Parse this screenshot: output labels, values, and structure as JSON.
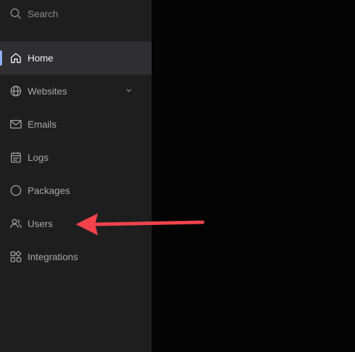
{
  "search": {
    "placeholder": "Search"
  },
  "nav": {
    "items": [
      {
        "label": "Home",
        "icon": "home-icon",
        "active": true
      },
      {
        "label": "Websites",
        "icon": "globe-icon",
        "has_chevron": true
      },
      {
        "label": "Emails",
        "icon": "mail-icon"
      },
      {
        "label": "Logs",
        "icon": "calendar-icon"
      },
      {
        "label": "Packages",
        "icon": "circle-icon"
      },
      {
        "label": "Users",
        "icon": "users-icon"
      },
      {
        "label": "Integrations",
        "icon": "grid-shapes-icon"
      }
    ]
  },
  "colors": {
    "sidebar_bg": "#1e1e1f",
    "active_bg": "#2f2f31",
    "accent": "#8fb3ff",
    "annotation_arrow": "#f2434b",
    "main_bg": "#040404"
  }
}
